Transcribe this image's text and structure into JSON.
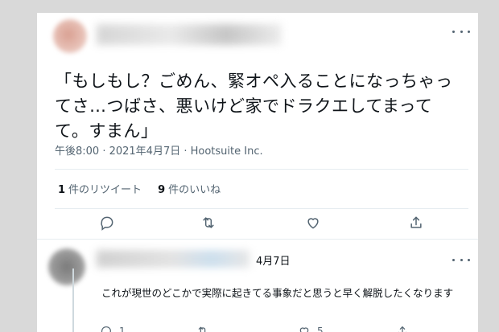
{
  "tweet": {
    "text": "「もしもし？ごめん、緊オペ入ることになっちゃってさ…つばさ、悪いけど家でドラクエしてまってて。すまん」",
    "timestamp": "午後8:00 · 2021年4月7日 · Hootsuite Inc.",
    "retweets_count": "1",
    "retweets_label": "件のリツイート",
    "likes_count": "9",
    "likes_label": "件のいいね"
  },
  "reply": {
    "date": "4月7日",
    "text": "これが現世のどこかで実際に起きてる事象だと思うと早く解脱したくなります",
    "reply_count": "1",
    "like_count": "5"
  },
  "icons": {
    "more": "more-icon",
    "reply": "reply-icon",
    "retweet": "retweet-icon",
    "like": "heart-icon",
    "share": "share-icon"
  },
  "colors": {
    "text": "#0f1419",
    "secondary": "#536471",
    "divider": "#e6ecf0",
    "background": "#d9d9d9"
  }
}
